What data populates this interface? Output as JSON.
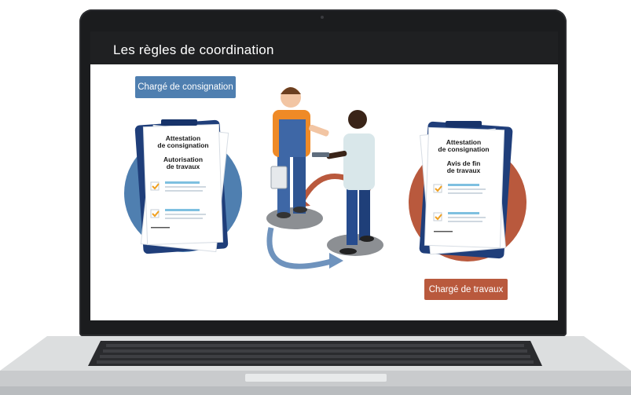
{
  "slide": {
    "title": "Les règles de coordination"
  },
  "roles": {
    "consignation_label": "Chargé de consignation",
    "travaux_label": "Chargé de travaux"
  },
  "doc_left": {
    "title_line1": "Attestation",
    "title_line2": "de consignation",
    "subtitle_line1": "Autorisation",
    "subtitle_line2": "de travaux"
  },
  "doc_right": {
    "title_line1": "Attestation",
    "title_line2": "de consignation",
    "subtitle_line1": "Avis de fin",
    "subtitle_line2": "de travaux"
  },
  "colors": {
    "blue_accent": "#4f7fb0",
    "rust_accent": "#b9593d",
    "checkbox_orange": "#f0a020",
    "header_bg": "#1f2022"
  }
}
